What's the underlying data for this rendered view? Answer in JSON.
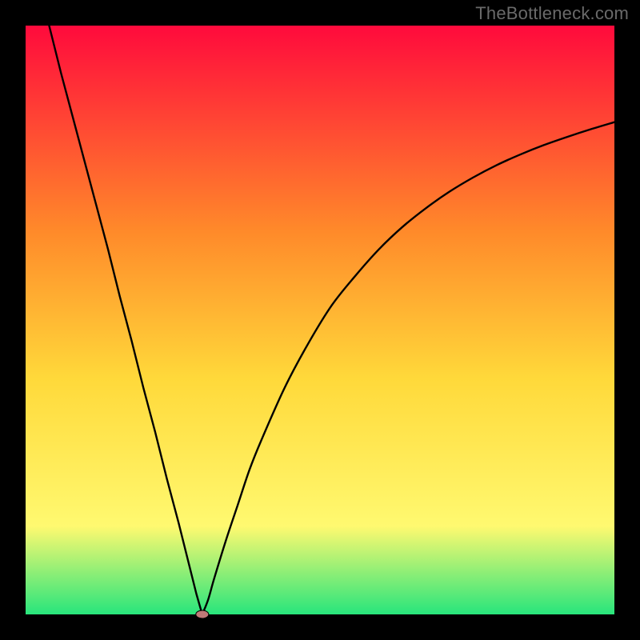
{
  "source_label": "TheBottleneck.com",
  "chart_data": {
    "type": "line",
    "title": "",
    "xlabel": "",
    "ylabel": "",
    "xlim": [
      0,
      100
    ],
    "ylim": [
      0,
      100
    ],
    "grid": false,
    "legend": false,
    "background_gradient": {
      "top_color": "#ff0a3c",
      "mid_upper_color": "#ff8a2a",
      "mid_color": "#ffd93a",
      "mid_lower_color": "#fff970",
      "bottom_color": "#28e57c"
    },
    "marker": {
      "x": 30,
      "y": 0,
      "color": "#c07a78",
      "rx": 8,
      "ry": 5
    },
    "series": [
      {
        "name": "bottleneck-curve",
        "segment": "left",
        "x": [
          4,
          6,
          8,
          10,
          12,
          14,
          16,
          18,
          20,
          22,
          24,
          26,
          28,
          29,
          30
        ],
        "y": [
          100,
          92,
          84.5,
          77,
          69.5,
          62,
          54,
          46.5,
          38.5,
          31,
          23,
          15.5,
          7.5,
          3.5,
          0
        ]
      },
      {
        "name": "bottleneck-curve",
        "segment": "right",
        "x": [
          30,
          31,
          32,
          34,
          36,
          38,
          40,
          44,
          48,
          52,
          56,
          60,
          64,
          68,
          72,
          76,
          80,
          84,
          88,
          92,
          96,
          100
        ],
        "y": [
          0,
          2.5,
          6,
          12.5,
          18.5,
          24.5,
          29.5,
          38.5,
          46,
          52.5,
          57.5,
          62,
          65.8,
          69,
          71.8,
          74.2,
          76.3,
          78.1,
          79.7,
          81.1,
          82.4,
          83.6
        ]
      }
    ]
  }
}
